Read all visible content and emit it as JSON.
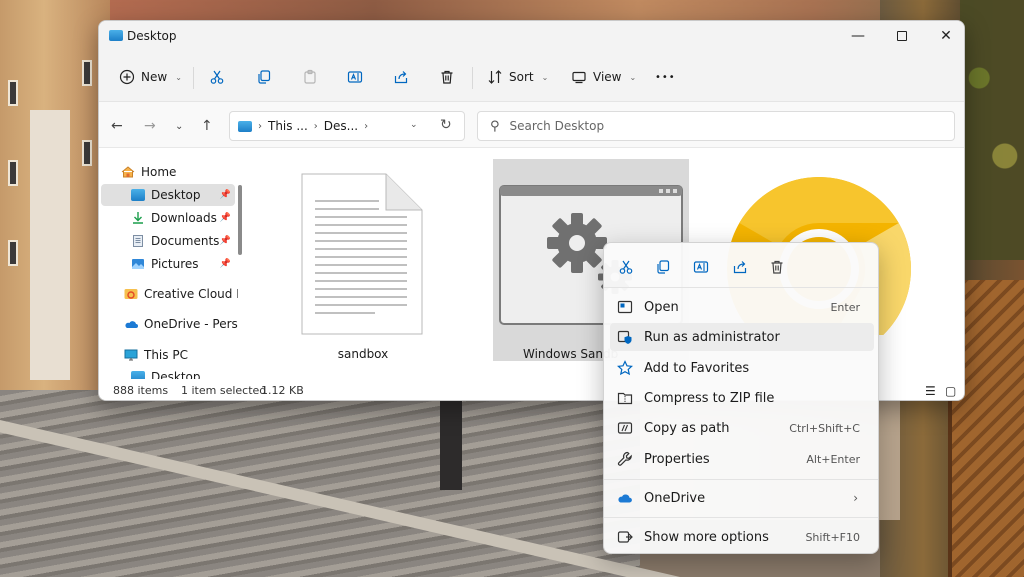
{
  "window": {
    "title": "Desktop",
    "controls": {
      "minimize": "—",
      "close": "✕"
    }
  },
  "toolbar": {
    "new_label": "New",
    "sort_label": "Sort",
    "view_label": "View",
    "more_label": "•••"
  },
  "address": {
    "crumbs": [
      "This ...",
      "Des..."
    ],
    "search_placeholder": "Search Desktop"
  },
  "nav": {
    "items": [
      {
        "label": "Home",
        "icon": "home-icon"
      },
      {
        "label": "Desktop",
        "icon": "desktop-folder-icon",
        "selected": true,
        "pinned": true
      },
      {
        "label": "Downloads",
        "icon": "download-icon",
        "pinned": true
      },
      {
        "label": "Documents",
        "icon": "documents-icon",
        "pinned": true
      },
      {
        "label": "Pictures",
        "icon": "pictures-icon",
        "pinned": true
      },
      {
        "label": "Creative Cloud Fil",
        "icon": "creative-cloud-icon"
      },
      {
        "label": "OneDrive - Persor",
        "icon": "onedrive-icon"
      },
      {
        "label": "This PC",
        "icon": "this-pc-icon"
      },
      {
        "label": "Desktop",
        "icon": "desktop-folder-icon"
      }
    ]
  },
  "files": [
    {
      "name": "sandbox",
      "icon": "text-file-icon"
    },
    {
      "name": "Windows Sandb",
      "icon": "windows-sandbox-icon",
      "selected": true
    },
    {
      "name": "",
      "icon": "chrome-canary-icon"
    }
  ],
  "status": {
    "count": "888 items",
    "selection": "1 item selected",
    "size": "1.12 KB"
  },
  "context_menu": {
    "quick_actions": [
      "cut-icon",
      "copy-icon",
      "rename-icon",
      "share-icon",
      "delete-icon"
    ],
    "items": [
      {
        "label": "Open",
        "accel": "Enter"
      },
      {
        "label": "Run as administrator",
        "accel": ""
      },
      {
        "label": "Add to Favorites",
        "accel": ""
      },
      {
        "label": "Compress to ZIP file",
        "accel": ""
      },
      {
        "label": "Copy as path",
        "accel": "Ctrl+Shift+C"
      },
      {
        "label": "Properties",
        "accel": "Alt+Enter"
      },
      {
        "label": "OneDrive",
        "accel": ""
      },
      {
        "label": "Show more options",
        "accel": "Shift+F10"
      }
    ],
    "submenu_arrow": "›"
  },
  "colors": {
    "accent": "#0067c0",
    "selection": "#d9d9d9",
    "chrome_yellow": "#f4b400"
  }
}
